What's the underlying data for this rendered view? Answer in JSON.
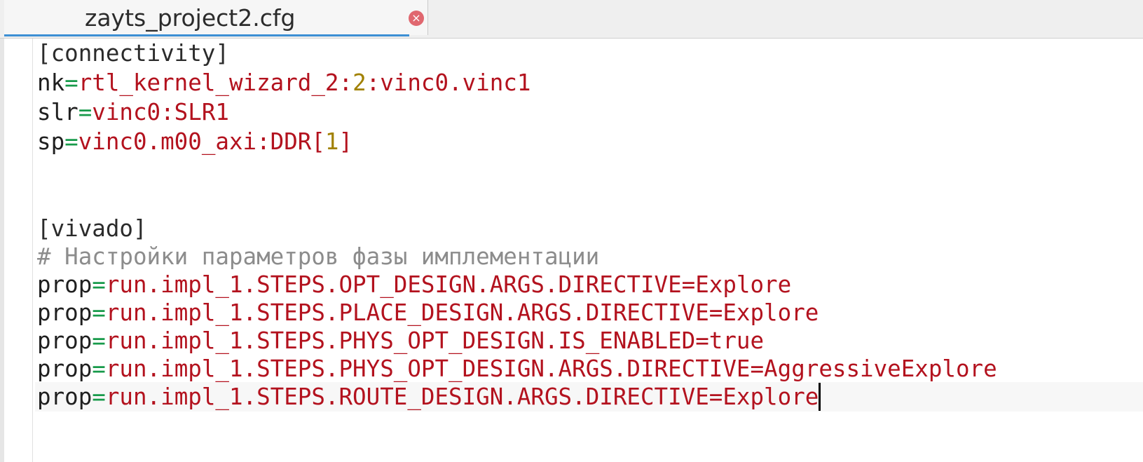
{
  "tab": {
    "filename": "zayts_project2.cfg",
    "close_glyph": "×"
  },
  "editor": {
    "lines": [
      {
        "section": "[connectivity]"
      },
      {
        "key": "nk",
        "eq": "=",
        "v1": "rtl_kernel_wizard_2:",
        "num": "2",
        "v2": ":vinc0.vinc1"
      },
      {
        "key": "slr",
        "eq": "=",
        "v1": "vinc0:SLR1"
      },
      {
        "key": "sp",
        "eq": "=",
        "v1": "vinc0.m00_axi:DDR[",
        "num": "1",
        "v2": "]"
      },
      {
        "section": "[vivado]"
      },
      {
        "comment": "# Настройки параметров фазы имплементации"
      },
      {
        "key": "prop",
        "eq": "=",
        "v1": "run.impl_1.STEPS.OPT_DESIGN.ARGS.DIRECTIVE=Explore"
      },
      {
        "key": "prop",
        "eq": "=",
        "v1": "run.impl_1.STEPS.PLACE_DESIGN.ARGS.DIRECTIVE=Explore"
      },
      {
        "key": "prop",
        "eq": "=",
        "v1": "run.impl_1.STEPS.PHYS_OPT_DESIGN.IS_ENABLED=true"
      },
      {
        "key": "prop",
        "eq": "=",
        "v1": "run.impl_1.STEPS.PHYS_OPT_DESIGN.ARGS.DIRECTIVE=AggressiveExplore"
      },
      {
        "key": "prop",
        "eq": "=",
        "v1": "run.impl_1.STEPS.ROUTE_DESIGN.ARGS.DIRECTIVE=Explore"
      }
    ]
  },
  "colors": {
    "key": "#1f1f1f",
    "equals": "#179a4a",
    "value": "#b3121e",
    "number": "#a18100",
    "comment": "#8c8c8c",
    "tab_accent": "#3d8fd4",
    "close_button": "#e0676f"
  }
}
